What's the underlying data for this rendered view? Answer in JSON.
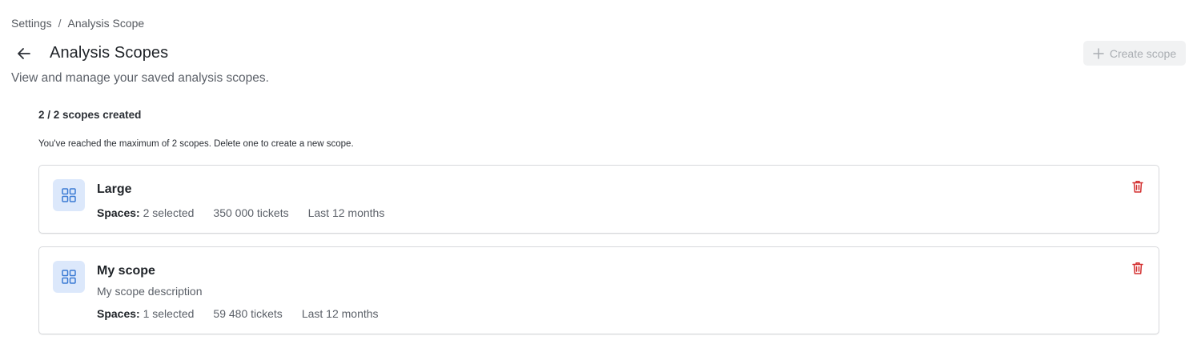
{
  "breadcrumb": {
    "items": [
      "Settings",
      "Analysis Scope"
    ],
    "separator": "/"
  },
  "header": {
    "back_icon": "arrow-left-icon",
    "title": "Analysis Scopes",
    "subtitle": "View and manage your saved analysis scopes.",
    "create_button": {
      "label": "Create scope",
      "icon": "plus-icon",
      "disabled": true
    }
  },
  "summary": {
    "count_text": "2 / 2 scopes created",
    "limit_note": "You've reached the maximum of 2 scopes. Delete one to create a new scope."
  },
  "scopes": [
    {
      "name": "Large",
      "description": "",
      "spaces_label": "Spaces:",
      "spaces_value": "2 selected",
      "tickets": "350 000 tickets",
      "period": "Last 12 months",
      "icon": "grid-icon",
      "delete_icon": "trash-icon"
    },
    {
      "name": "My scope",
      "description": "My scope description",
      "spaces_label": "Spaces:",
      "spaces_value": "1 selected",
      "tickets": "59 480 tickets",
      "period": "Last 12 months",
      "icon": "grid-icon",
      "delete_icon": "trash-icon"
    }
  ],
  "colors": {
    "accent": "#3b7bd4",
    "icon_bg": "#dce8fb",
    "danger": "#d32f2f",
    "disabled_text": "#a9adb2"
  }
}
